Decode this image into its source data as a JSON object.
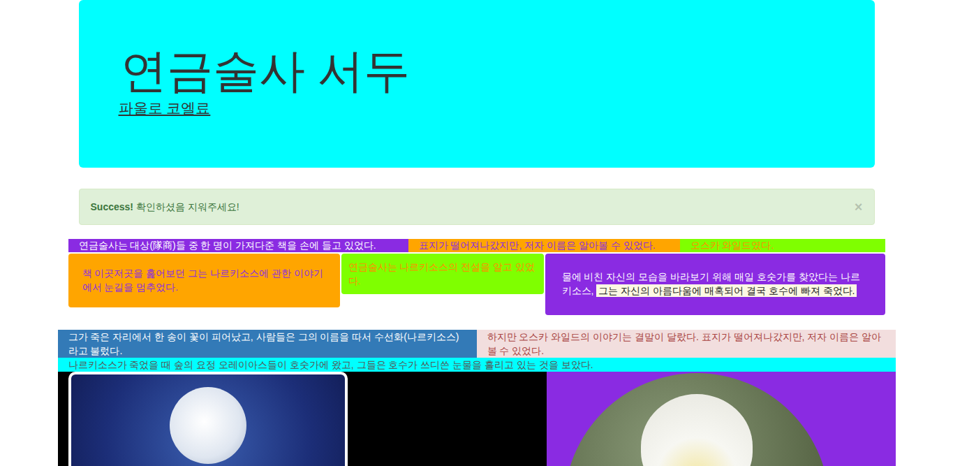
{
  "jumbotron": {
    "title": "연금술사 서두",
    "link": "파울로 코엘료"
  },
  "alert": {
    "strong": "Success!",
    "text": " 확인하셨음 지워주세요!",
    "close": "×"
  },
  "strip": [
    {
      "text": "연금술사는 대상(隊商)들 중 한 명이 가져다준 책을 손에 들고 있었다.",
      "color": "#8a2be2",
      "text_color": "#ffffff"
    },
    {
      "text": "표지가 떨어져나갔지만, 저자 이름은 알아볼 수 있었다.",
      "color": "#ffa500",
      "text_color": "#8a2be2"
    },
    {
      "text": "오스카 와일드였다.",
      "color": "#7fff00",
      "text_color": "#ff8c00"
    }
  ],
  "cards": [
    {
      "text": "책 이곳저곳을 훑어보던 그는 나르키소스에 관한 이야기에서 눈길을 멈추었다.",
      "mark": "",
      "color": "#ffa500",
      "text_color": "#8a2be2"
    },
    {
      "text": "연금술사는 나르키소스의 전설을 알고 있었다.",
      "mark": "",
      "color": "#7fff00",
      "text_color": "#ff8c00"
    },
    {
      "text": "물에 비친 자신의 모습을 바라보기 위해 매일 호숫가를 찾았다는 나르키소스, ",
      "mark": "그는 자신의 아름다움에 매혹되어 결국 호수에 빠져 죽었다.",
      "color": "#8a2be2",
      "text_color": "#ffffff"
    }
  ],
  "panels": [
    {
      "text": "그가 죽은 자리에서 한 송이 꽃이 피어났고, 사람들은 그의 이름을 따서 수선화(나르키소스)라고 불렀다.",
      "color": "#337ab7",
      "text_color": "#ffffff"
    },
    {
      "text": "하지만 오스카 와일드의 이야기는 결말이 달랐다. 표지가 떨어져나갔지만, 저자 이름은 알아볼 수 있었다.",
      "color": "#f2dede",
      "text_color": "#a94442"
    }
  ],
  "banner": {
    "text": "나르키소스가 죽었을 때 숲의 요정 오레이아스들이 호숫가에 왔고, 그들은 호수가 쓰디쓴 눈물을 흘리고 있는 것을 보았다.",
    "color": "#00ffff",
    "text_color": "#555555"
  },
  "images": [
    {
      "kind": "framed",
      "color": "#000000"
    },
    {
      "kind": "round",
      "color": "#8a2be2"
    }
  ]
}
